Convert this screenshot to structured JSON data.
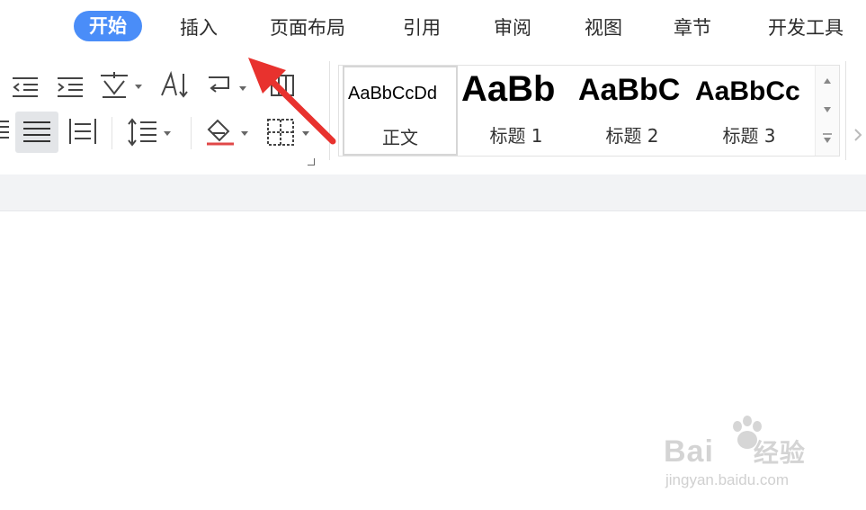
{
  "tabs": [
    {
      "label": "开始",
      "active": true
    },
    {
      "label": "插入"
    },
    {
      "label": "页面布局"
    },
    {
      "label": "引用"
    },
    {
      "label": "审阅"
    },
    {
      "label": "视图"
    },
    {
      "label": "章节"
    },
    {
      "label": "开发工具"
    }
  ],
  "colors": {
    "accent": "#4a8df8",
    "arrow": "#e8322e",
    "ribbon_bottom": "#f2f3f5"
  },
  "toolbar": {
    "row1": [
      "decrease-indent-icon",
      "increase-indent-icon",
      "chinese-layout-icon",
      "text-direction-icon",
      "paragraph-mark-icon",
      "show-hide-icon"
    ],
    "row2": [
      "align-left-icon",
      "justify-icon",
      "distributed-align-icon",
      "line-spacing-icon",
      "shading-icon",
      "borders-icon"
    ]
  },
  "styles": [
    {
      "preview": "AaBbCcDd",
      "name": "正文",
      "selected": true
    },
    {
      "preview": "AaBb",
      "name": "标题 1"
    },
    {
      "preview": "AaBbC",
      "name": "标题 2"
    },
    {
      "preview": "AaBbCc",
      "name": "标题 3"
    }
  ],
  "watermark": {
    "brand": "Bai",
    "brand2": "经验",
    "url": "jingyan.baidu.com"
  }
}
